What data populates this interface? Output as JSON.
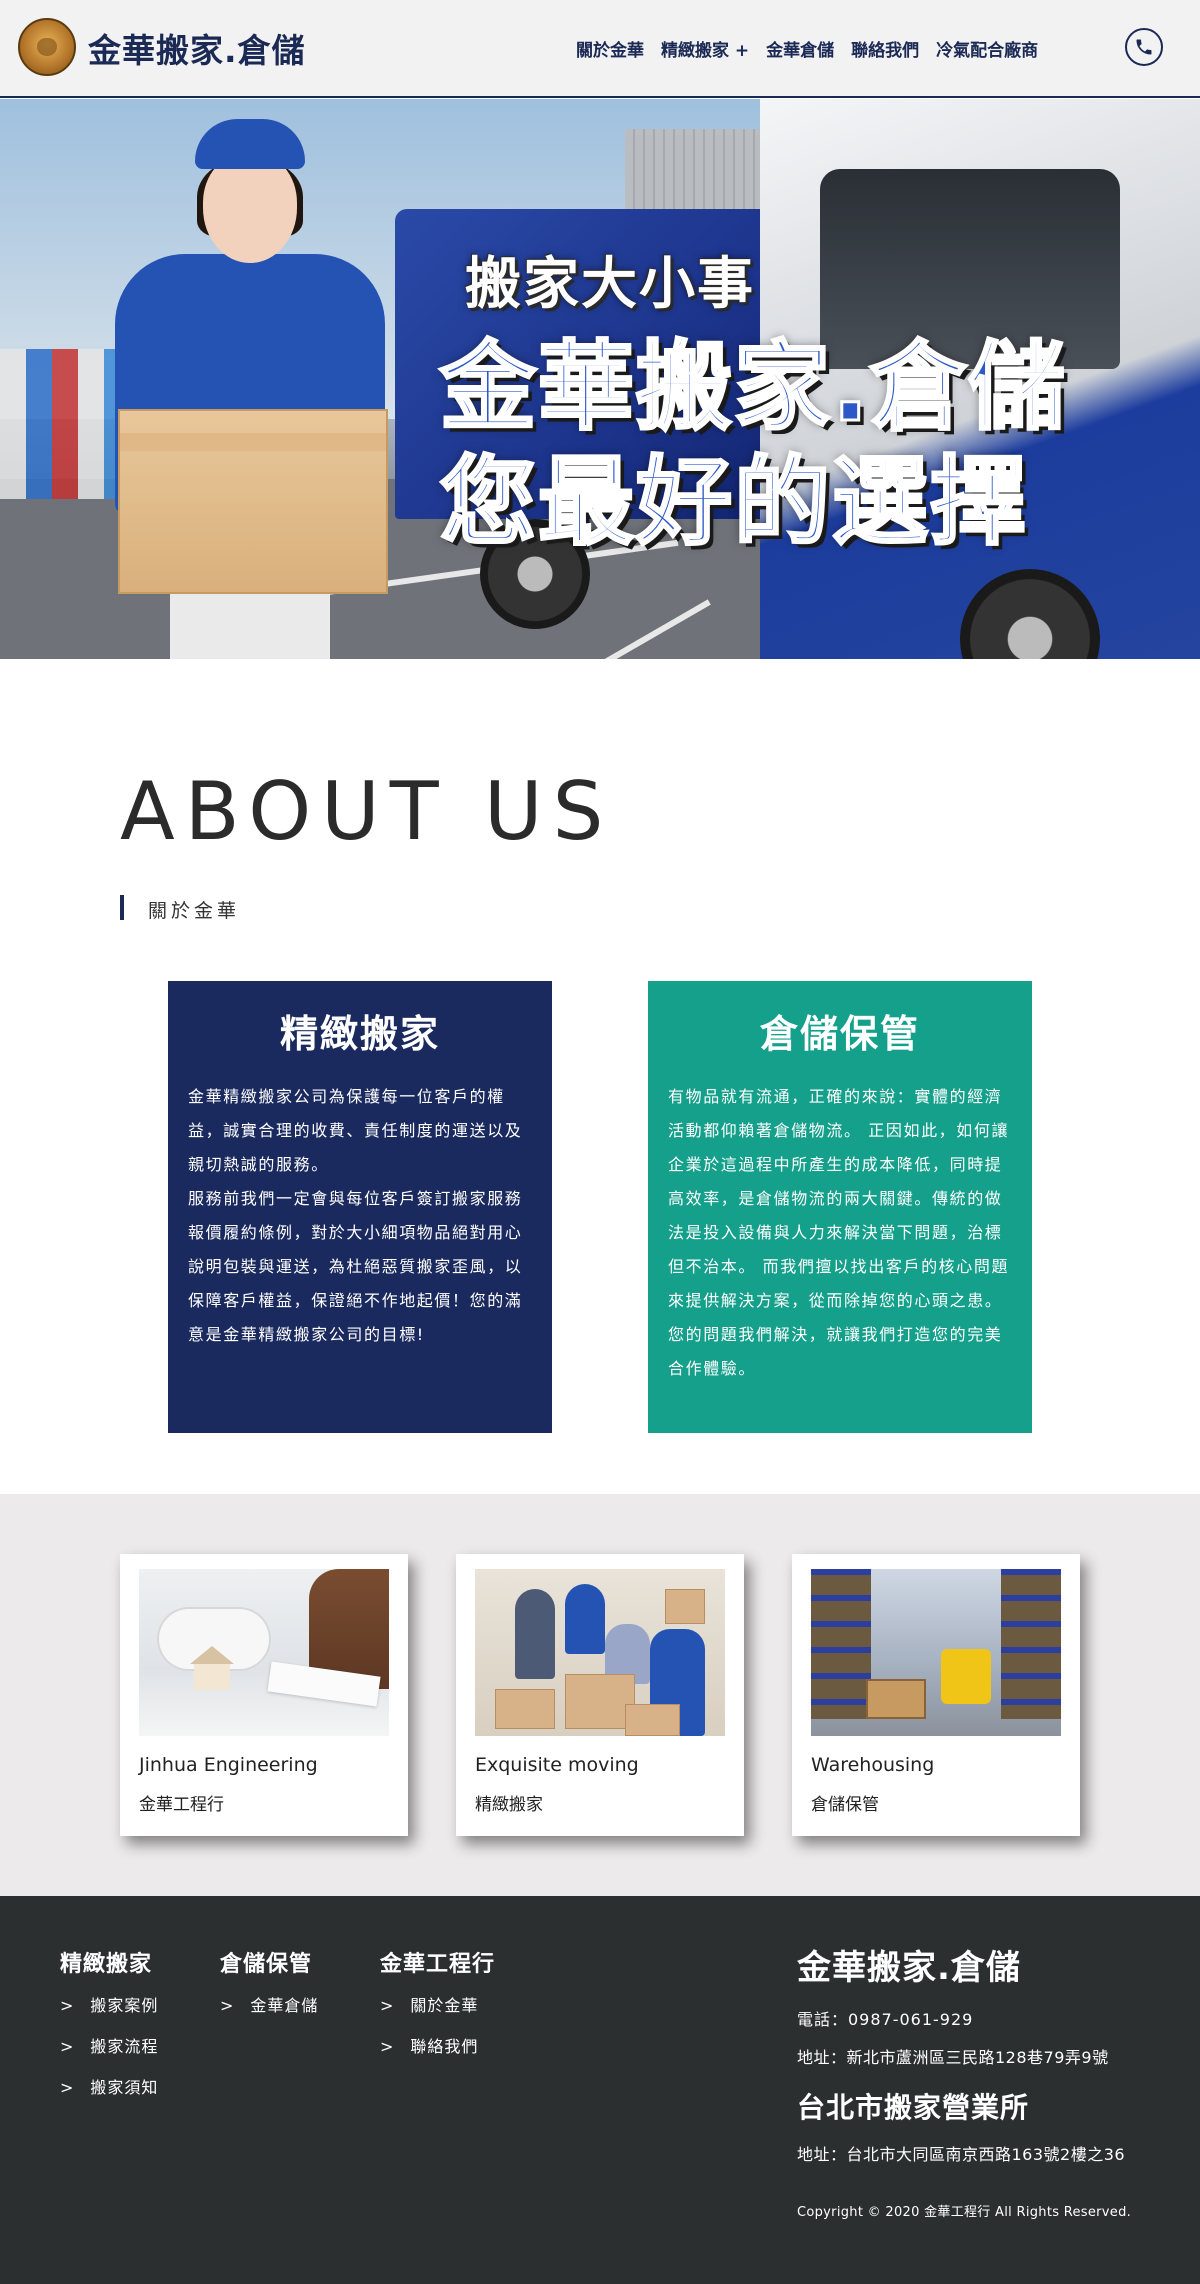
{
  "header": {
    "brand": "金華搬家.倉儲",
    "nav": [
      "關於金華",
      "精緻搬家 +",
      "金華倉儲",
      "聯絡我們",
      "冷氣配合廠商"
    ]
  },
  "hero": {
    "line1": "搬家大小事",
    "line2": "金華搬家.倉儲",
    "line3": "您最好的選擇"
  },
  "about": {
    "title": "ABOUT US",
    "subtitle": "關於金華"
  },
  "cards": [
    {
      "title": "精緻搬家",
      "paragraphs": [
        "金華精緻搬家公司為保護每一位客戶的權益，誠實合理的收費、責任制度的運送以及親切熱誠的服務。",
        "服務前我們一定會與每位客戶簽訂搬家服務報價履約條例，對於大小細項物品絕對用心說明包裝與運送，為杜絕惡質搬家歪風，以保障客戶權益，保證絕不作地起價！您的滿意是金華精緻搬家公司的目標!"
      ],
      "color": "#1b2a5e"
    },
    {
      "title": "倉儲保管",
      "paragraphs": [
        "有物品就有流通，正確的來說：實體的經濟活動都仰賴著倉儲物流。 正因如此，如何讓企業於這過程中所產生的成本降低，同時提高效率，是倉儲物流的兩大關鍵。傳統的做法是投入設備與人力來解決當下問題，治標但不治本。 而我們擅以找出客戶的核心問題來提供解決方案，從而除掉您的心頭之患。",
        "您的問題我們解決，就讓我們打造您的完美合作體驗。"
      ],
      "color": "#15a08c"
    }
  ],
  "services": [
    {
      "en": "Jinhua Engineering",
      "zh": "金華工程行"
    },
    {
      "en": "Exquisite moving",
      "zh": "精緻搬家"
    },
    {
      "en": "Warehousing",
      "zh": "倉儲保管"
    }
  ],
  "footer": {
    "columns": [
      {
        "title": "精緻搬家",
        "items": [
          "搬家案例",
          "搬家流程",
          "搬家須知"
        ]
      },
      {
        "title": "倉儲保管",
        "items": [
          "金華倉儲"
        ]
      },
      {
        "title": "金華工程行",
        "items": [
          "關於金華",
          "聯絡我們"
        ]
      }
    ],
    "arrow": ">",
    "brand": "金華搬家.倉儲",
    "tel": "電話：0987-061-929",
    "address1": "地址：新北市蘆洲區三民路128巷79弄9號",
    "branch": "台北市搬家營業所",
    "address2": "地址：台北市大同區南京西路163號2樓之36",
    "copyright": "Copyright © 2020 金華工程行 All Rights Reserved."
  }
}
